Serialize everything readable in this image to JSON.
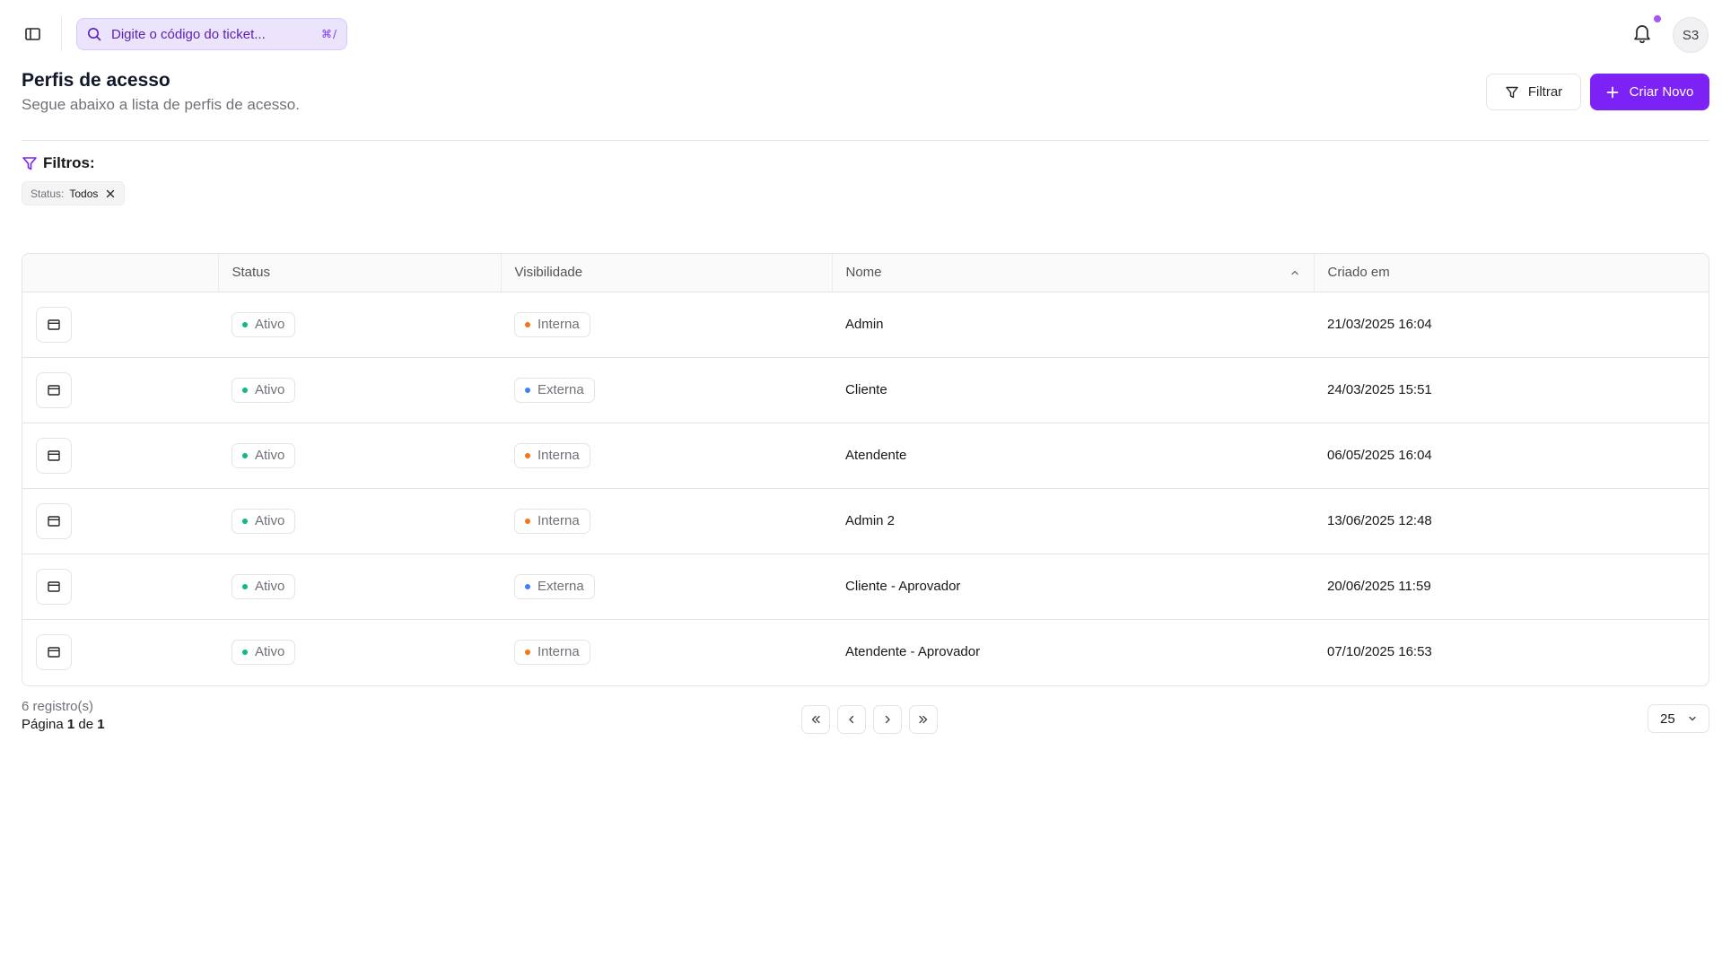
{
  "search": {
    "placeholder": "Digite o código do ticket...",
    "shortcut": "⌘/"
  },
  "user": {
    "initials": "S3"
  },
  "header": {
    "title": "Perfis de acesso",
    "subtitle": "Segue abaixo a lista de perfis de acesso.",
    "filter_label": "Filtrar",
    "create_label": "Criar Novo"
  },
  "filters": {
    "title": "Filtros:",
    "chip": {
      "key": "Status:",
      "value": "Todos"
    }
  },
  "table": {
    "columns": [
      "",
      "Status",
      "Visibilidade",
      "Nome",
      "Criado em"
    ],
    "rows": [
      {
        "status": "Ativo",
        "visibility": "Interna",
        "name": "Admin",
        "created": "21/03/2025 16:04"
      },
      {
        "status": "Ativo",
        "visibility": "Externa",
        "name": "Cliente",
        "created": "24/03/2025 15:51"
      },
      {
        "status": "Ativo",
        "visibility": "Interna",
        "name": "Atendente",
        "created": "06/05/2025 16:04"
      },
      {
        "status": "Ativo",
        "visibility": "Interna",
        "name": "Admin 2",
        "created": "13/06/2025 12:48"
      },
      {
        "status": "Ativo",
        "visibility": "Externa",
        "name": "Cliente - Aprovador",
        "created": "20/06/2025 11:59"
      },
      {
        "status": "Ativo",
        "visibility": "Interna",
        "name": "Atendente - Aprovador",
        "created": "07/10/2025 16:53"
      }
    ]
  },
  "footer": {
    "records": "6 registro(s)",
    "page_word": "Página",
    "page_current": "1",
    "of_word": "de",
    "page_total": "1",
    "page_size": "25"
  },
  "colors": {
    "accent": "#7c22f5",
    "status_active": "#10b981",
    "visibility_interna": "#f97316",
    "visibility_externa": "#3b82f6"
  },
  "icons": {
    "sidebar_toggle": "panel-left-icon",
    "search": "search-icon",
    "notifications": "bell-icon",
    "filter": "funnel-icon",
    "create": "plus-icon",
    "row_action": "window-icon",
    "sort": "chevron-up-icon"
  }
}
